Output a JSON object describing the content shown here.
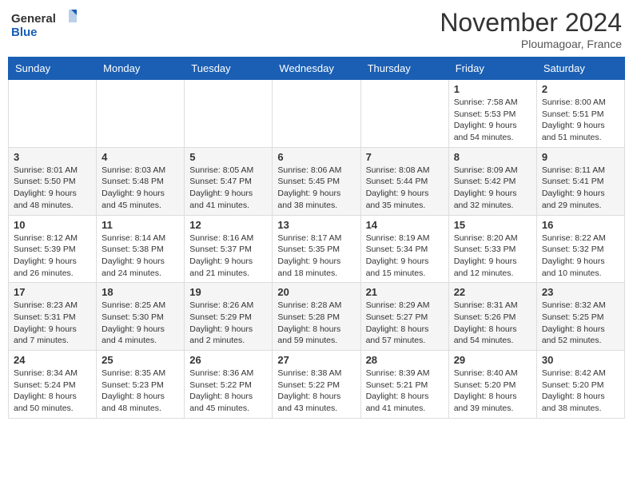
{
  "logo": {
    "line1": "General",
    "line2": "Blue"
  },
  "title": "November 2024",
  "location": "Ploumagoar, France",
  "weekdays": [
    "Sunday",
    "Monday",
    "Tuesday",
    "Wednesday",
    "Thursday",
    "Friday",
    "Saturday"
  ],
  "weeks": [
    [
      {
        "day": "",
        "info": ""
      },
      {
        "day": "",
        "info": ""
      },
      {
        "day": "",
        "info": ""
      },
      {
        "day": "",
        "info": ""
      },
      {
        "day": "",
        "info": ""
      },
      {
        "day": "1",
        "info": "Sunrise: 7:58 AM\nSunset: 5:53 PM\nDaylight: 9 hours and 54 minutes."
      },
      {
        "day": "2",
        "info": "Sunrise: 8:00 AM\nSunset: 5:51 PM\nDaylight: 9 hours and 51 minutes."
      }
    ],
    [
      {
        "day": "3",
        "info": "Sunrise: 8:01 AM\nSunset: 5:50 PM\nDaylight: 9 hours and 48 minutes."
      },
      {
        "day": "4",
        "info": "Sunrise: 8:03 AM\nSunset: 5:48 PM\nDaylight: 9 hours and 45 minutes."
      },
      {
        "day": "5",
        "info": "Sunrise: 8:05 AM\nSunset: 5:47 PM\nDaylight: 9 hours and 41 minutes."
      },
      {
        "day": "6",
        "info": "Sunrise: 8:06 AM\nSunset: 5:45 PM\nDaylight: 9 hours and 38 minutes."
      },
      {
        "day": "7",
        "info": "Sunrise: 8:08 AM\nSunset: 5:44 PM\nDaylight: 9 hours and 35 minutes."
      },
      {
        "day": "8",
        "info": "Sunrise: 8:09 AM\nSunset: 5:42 PM\nDaylight: 9 hours and 32 minutes."
      },
      {
        "day": "9",
        "info": "Sunrise: 8:11 AM\nSunset: 5:41 PM\nDaylight: 9 hours and 29 minutes."
      }
    ],
    [
      {
        "day": "10",
        "info": "Sunrise: 8:12 AM\nSunset: 5:39 PM\nDaylight: 9 hours and 26 minutes."
      },
      {
        "day": "11",
        "info": "Sunrise: 8:14 AM\nSunset: 5:38 PM\nDaylight: 9 hours and 24 minutes."
      },
      {
        "day": "12",
        "info": "Sunrise: 8:16 AM\nSunset: 5:37 PM\nDaylight: 9 hours and 21 minutes."
      },
      {
        "day": "13",
        "info": "Sunrise: 8:17 AM\nSunset: 5:35 PM\nDaylight: 9 hours and 18 minutes."
      },
      {
        "day": "14",
        "info": "Sunrise: 8:19 AM\nSunset: 5:34 PM\nDaylight: 9 hours and 15 minutes."
      },
      {
        "day": "15",
        "info": "Sunrise: 8:20 AM\nSunset: 5:33 PM\nDaylight: 9 hours and 12 minutes."
      },
      {
        "day": "16",
        "info": "Sunrise: 8:22 AM\nSunset: 5:32 PM\nDaylight: 9 hours and 10 minutes."
      }
    ],
    [
      {
        "day": "17",
        "info": "Sunrise: 8:23 AM\nSunset: 5:31 PM\nDaylight: 9 hours and 7 minutes."
      },
      {
        "day": "18",
        "info": "Sunrise: 8:25 AM\nSunset: 5:30 PM\nDaylight: 9 hours and 4 minutes."
      },
      {
        "day": "19",
        "info": "Sunrise: 8:26 AM\nSunset: 5:29 PM\nDaylight: 9 hours and 2 minutes."
      },
      {
        "day": "20",
        "info": "Sunrise: 8:28 AM\nSunset: 5:28 PM\nDaylight: 8 hours and 59 minutes."
      },
      {
        "day": "21",
        "info": "Sunrise: 8:29 AM\nSunset: 5:27 PM\nDaylight: 8 hours and 57 minutes."
      },
      {
        "day": "22",
        "info": "Sunrise: 8:31 AM\nSunset: 5:26 PM\nDaylight: 8 hours and 54 minutes."
      },
      {
        "day": "23",
        "info": "Sunrise: 8:32 AM\nSunset: 5:25 PM\nDaylight: 8 hours and 52 minutes."
      }
    ],
    [
      {
        "day": "24",
        "info": "Sunrise: 8:34 AM\nSunset: 5:24 PM\nDaylight: 8 hours and 50 minutes."
      },
      {
        "day": "25",
        "info": "Sunrise: 8:35 AM\nSunset: 5:23 PM\nDaylight: 8 hours and 48 minutes."
      },
      {
        "day": "26",
        "info": "Sunrise: 8:36 AM\nSunset: 5:22 PM\nDaylight: 8 hours and 45 minutes."
      },
      {
        "day": "27",
        "info": "Sunrise: 8:38 AM\nSunset: 5:22 PM\nDaylight: 8 hours and 43 minutes."
      },
      {
        "day": "28",
        "info": "Sunrise: 8:39 AM\nSunset: 5:21 PM\nDaylight: 8 hours and 41 minutes."
      },
      {
        "day": "29",
        "info": "Sunrise: 8:40 AM\nSunset: 5:20 PM\nDaylight: 8 hours and 39 minutes."
      },
      {
        "day": "30",
        "info": "Sunrise: 8:42 AM\nSunset: 5:20 PM\nDaylight: 8 hours and 38 minutes."
      }
    ]
  ]
}
